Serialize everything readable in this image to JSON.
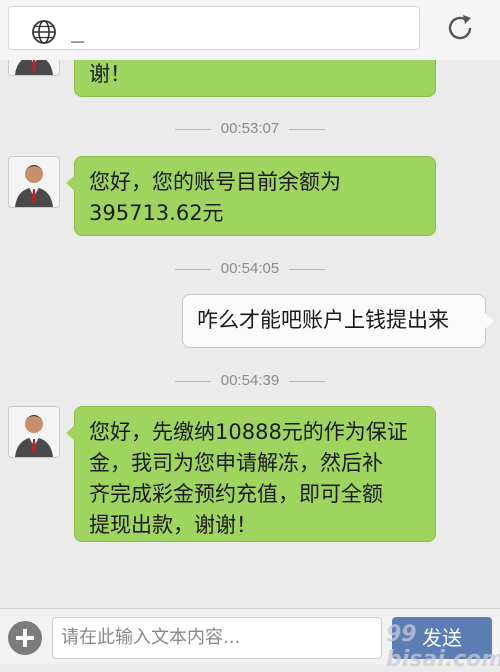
{
  "urlbar": {
    "text": "_"
  },
  "messages": {
    "m0": {
      "text": "谢！"
    },
    "t1": "00:53:07",
    "m1": {
      "line1": "您好，您的账号目前余额为",
      "line2": "395713.62元"
    },
    "t2": "00:54:05",
    "m2": {
      "text": "咋么才能吧账户上钱提出来"
    },
    "t3": "00:54:39",
    "m3": {
      "line1": "您好，先缴纳10888元的作为保证",
      "line2": "金，我司为您申请解冻，然后补",
      "line3": "齐完成彩金预约充值，即可全额",
      "line4": "提现出款，谢谢！"
    }
  },
  "composer": {
    "placeholder": "请在此输入文本内容...",
    "send_label": "发送"
  },
  "watermark": "99 bisai.com",
  "colors": {
    "incoming_bubble": "#9fd55f",
    "outgoing_bubble": "#fbfbfb",
    "send_button": "#5b7fb4"
  }
}
